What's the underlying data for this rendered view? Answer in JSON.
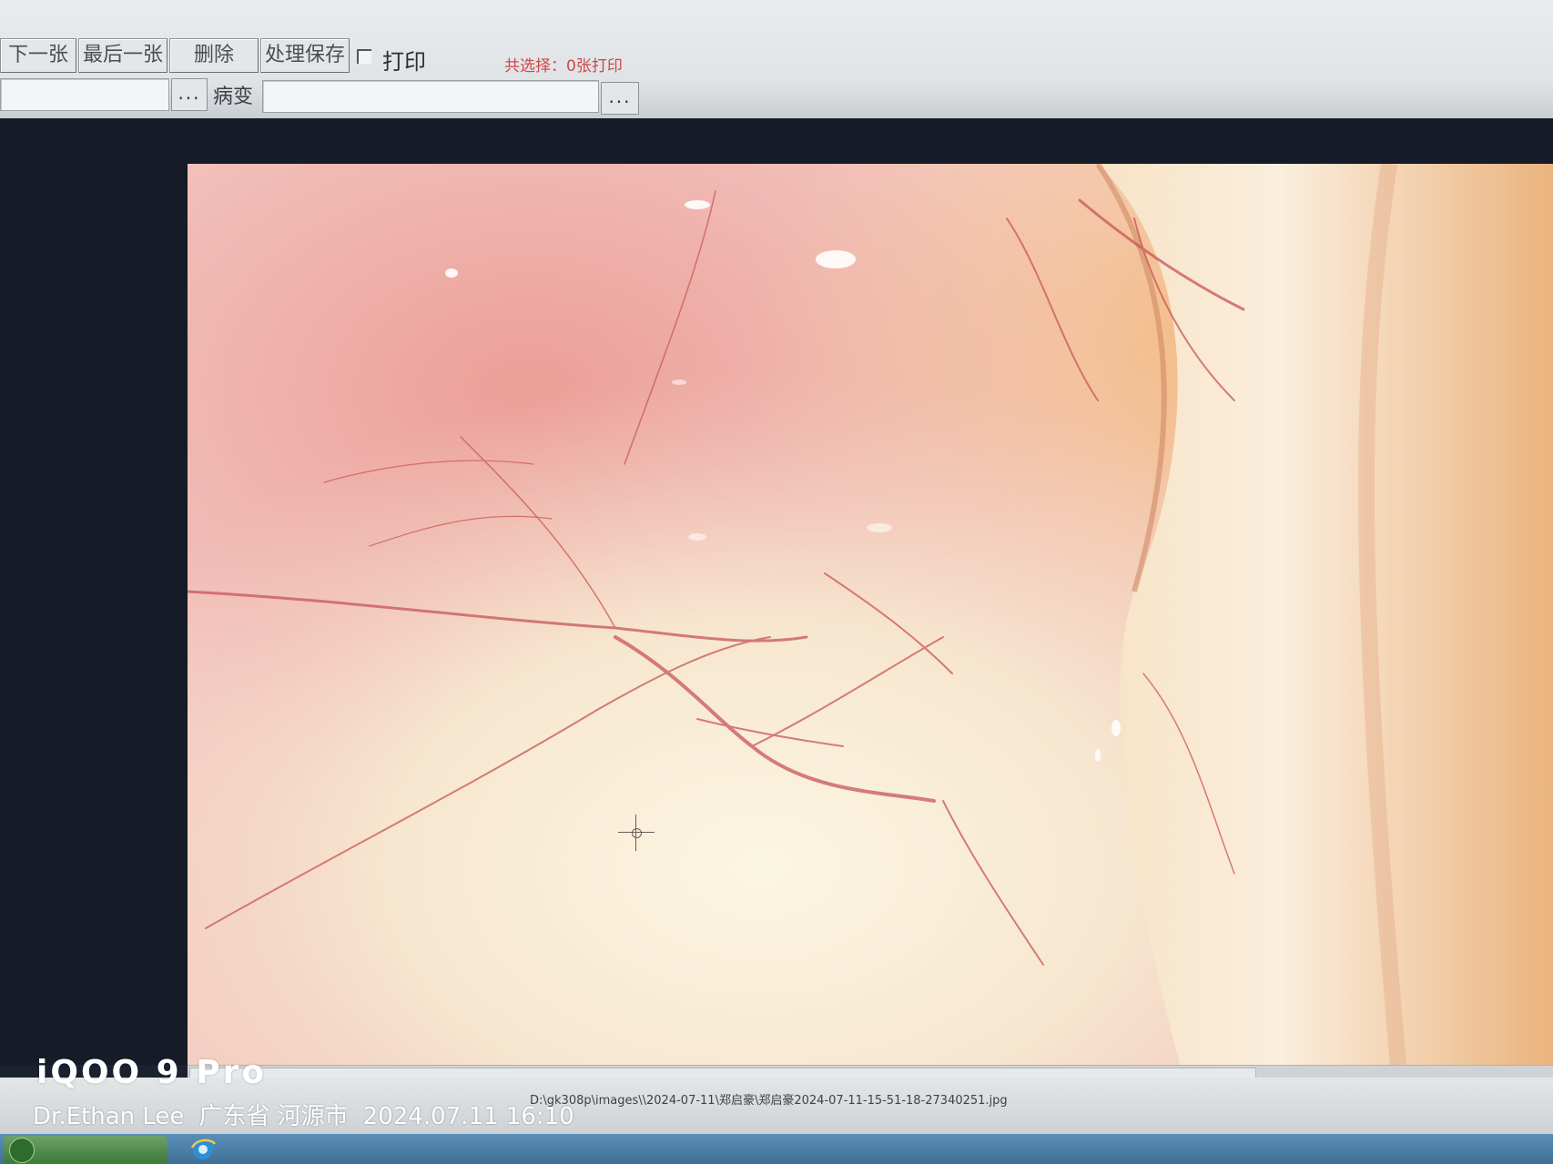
{
  "toolbar": {
    "buttons": [
      {
        "label": "下一张"
      },
      {
        "label": "最后一张"
      },
      {
        "label": "删除"
      },
      {
        "label": "处理保存"
      }
    ],
    "print_checkbox": {
      "label": "打印",
      "checked": false
    },
    "selection_status": "共选择：0张打印",
    "row2": {
      "browse_label": "...",
      "lesion_label": "病变",
      "lesion_value": "",
      "lesion_browse_label": "...",
      "first_field_value": ""
    }
  },
  "viewer": {
    "image_description_icon": "crosshair-cursor-icon"
  },
  "status": {
    "file_path": "D:\\gk308p\\images\\\\2024-07-11\\郑启豪\\郑启豪2024-07-11-15-51-18-27340251.jpg"
  },
  "watermark": {
    "model": "iQOO 9 Pro",
    "author": "Dr.Ethan Lee",
    "location": "广东省 河源市",
    "datetime": "2024.07.11 16:10"
  },
  "colors": {
    "accent_red": "#d24545",
    "viewer_bg": "#151c28",
    "taskbar": "#4a7fa8"
  }
}
